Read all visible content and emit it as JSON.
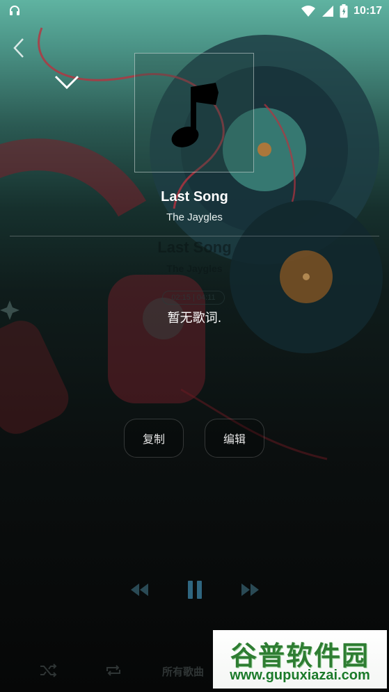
{
  "status_bar": {
    "time": "10:17",
    "icons": [
      "headphones-icon",
      "wifi-icon",
      "signal-icon",
      "battery-icon"
    ]
  },
  "player": {
    "song_title": "Last Song",
    "artist": "The Jaygles",
    "ghost_title": "Last Song",
    "ghost_artist": "The Jaygles",
    "ghost_time": "02:15 | 04:11",
    "no_lyrics": "暂无歌词."
  },
  "actions": {
    "copy_label": "复制",
    "edit_label": "编辑"
  },
  "bottom": {
    "playlist_label": "所有歌曲"
  },
  "watermark": {
    "title": "谷普软件园",
    "url": "www.gupuxiazai.com"
  },
  "colors": {
    "accent_teal": "#5fb3a1",
    "control_blue": "#4aa3d6",
    "watermark_green": "#2e7d32"
  }
}
